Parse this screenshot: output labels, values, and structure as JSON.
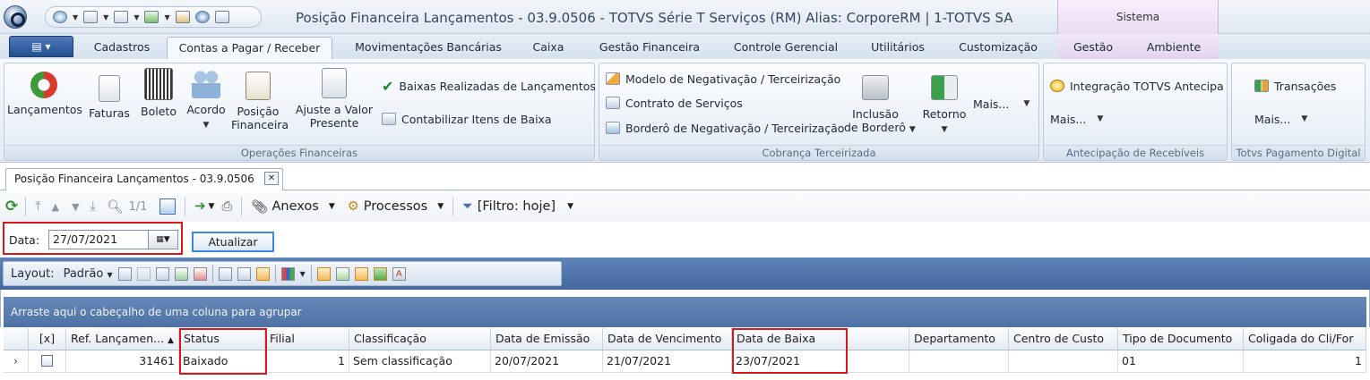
{
  "titlebar": {
    "title": "Posição Financeira Lançamentos - 03.9.0506 - TOTVS Série T Serviços (RM) Alias: CorporeRM | 1-TOTVS SA",
    "context_tab": "Sistema"
  },
  "tabs": [
    {
      "label": "Cadastros"
    },
    {
      "label": "Contas a Pagar / Receber",
      "active": true
    },
    {
      "label": "Movimentações Bancárias"
    },
    {
      "label": "Caixa"
    },
    {
      "label": "Gestão Financeira"
    },
    {
      "label": "Controle Gerencial"
    },
    {
      "label": "Utilitários"
    },
    {
      "label": "Customização"
    },
    {
      "label": "Gestão"
    },
    {
      "label": "Ambiente"
    }
  ],
  "ribbon": {
    "op_fin": {
      "caption": "Operações Financeiras",
      "lancamentos": "Lançamentos",
      "faturas": "Faturas",
      "boleto": "Boleto",
      "acordo": "Acordo",
      "posicao_l1": "Posição",
      "posicao_l2": "Financeira",
      "ajuste_l1": "Ajuste a Valor",
      "ajuste_l2": "Presente",
      "baixas": "Baixas Realizadas de Lançamentos",
      "contabilizar": "Contabilizar Itens de Baixa"
    },
    "cobranca": {
      "caption": "Cobrança Terceirizada",
      "modelo": "Modelo de Negativação / Terceirização",
      "contrato": "Contrato de Serviços",
      "bordero": "Borderô de Negativação / Terceirização",
      "inclusao_l1": "Inclusão",
      "inclusao_l2": "de Borderô",
      "retorno": "Retorno",
      "mais": "Mais..."
    },
    "antecipacao": {
      "caption": "Antecipação de Recebíveis",
      "integracao": "Integração TOTVS Antecipa",
      "mais": "Mais..."
    },
    "pagamento": {
      "caption": "Totvs Pagamento Digital",
      "transacoes": "Transações",
      "mais": "Mais..."
    }
  },
  "doc_tab": {
    "label": "Posição Financeira Lançamentos - 03.9.0506"
  },
  "toolbar": {
    "page": "1/1",
    "anexos": "Anexos",
    "processos": "Processos",
    "filtro": "[Filtro: hoje]"
  },
  "date_filter": {
    "label": "Data:",
    "value": "27/07/2021",
    "button": "Atualizar"
  },
  "layout_bar": {
    "label": "Layout:",
    "preset": "Padrão"
  },
  "group_hint": "Arraste aqui o cabeçalho de uma coluna para agrupar",
  "grid": {
    "columns": [
      "[x]",
      "Ref. Lançamen...",
      "Status",
      "Filial",
      "Classificação",
      "Data de Emissão",
      "Data de Vencimento",
      "Data de Baixa",
      "Departamento",
      "Centro de Custo",
      "Tipo de Documento",
      "Coligada do Cli/For"
    ],
    "row": {
      "ref": "31461",
      "status": "Baixado",
      "filial": "1",
      "classificacao": "Sem classificação",
      "emissao": "20/07/2021",
      "vencimento": "21/07/2021",
      "baixa": "23/07/2021",
      "departamento": "",
      "centro_custo": "",
      "tipo_doc": "01",
      "coligada": "1"
    }
  },
  "colors": {
    "highlight": "#d9181b",
    "accent": "#4e72a6"
  }
}
